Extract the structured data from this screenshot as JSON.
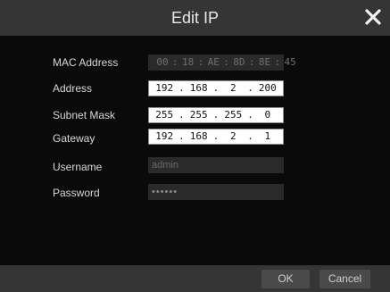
{
  "dialog": {
    "title": "Edit IP",
    "labels": {
      "mac": "MAC Address",
      "address": "Address",
      "subnet": "Subnet Mask",
      "gateway": "Gateway",
      "username": "Username",
      "password": "Password"
    },
    "mac": [
      "00",
      "18",
      "AE",
      "8D",
      "8E",
      "45"
    ],
    "address": [
      "192",
      "168",
      "2",
      "200"
    ],
    "subnet": [
      "255",
      "255",
      "255",
      "0"
    ],
    "gateway": [
      "192",
      "168",
      "2",
      "1"
    ],
    "username_placeholder": "admin",
    "password_value": "••••••",
    "ok_label": "OK",
    "cancel_label": "Cancel",
    "icons": {
      "close": "close-icon"
    },
    "colors": {
      "titlebar": "#353535",
      "background": "#0a0a0a",
      "input_bg": "#ffffff",
      "disabled_bg": "#2a2a2a"
    }
  }
}
